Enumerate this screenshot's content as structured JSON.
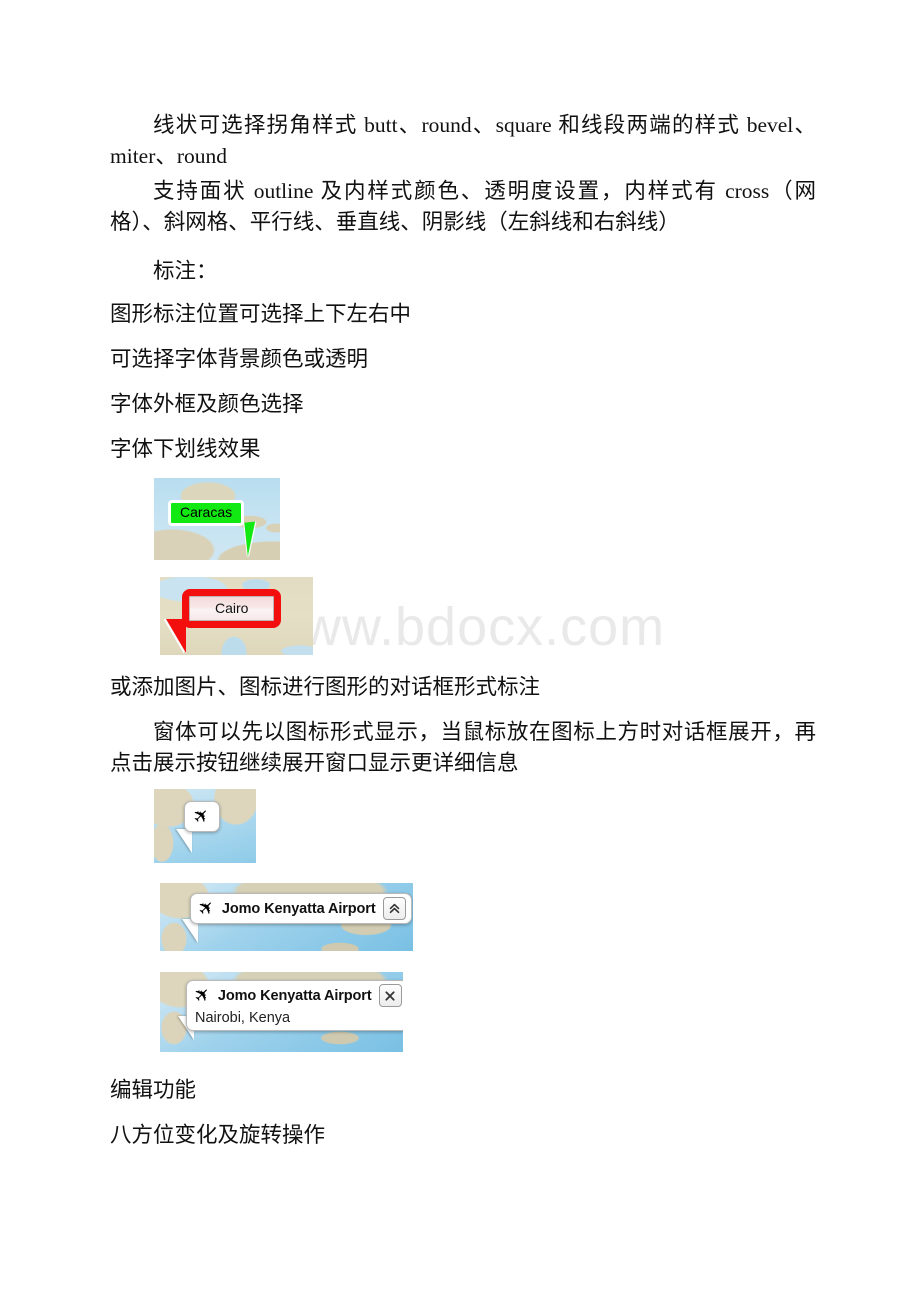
{
  "document": {
    "watermark": "www.bdocx.com",
    "paragraphs": [
      {
        "id": "p1",
        "text": "线状可选择拐角样式 butt、round、square 和线段两端的样式 bevel、miter、round",
        "indent": true
      },
      {
        "id": "p2",
        "text": "支持面状 outline 及内样式颜色、透明度设置，内样式有 cross（网格）、斜网格、平行线、垂直线、阴影线（左斜线和右斜线）",
        "indent": true
      },
      {
        "id": "p3",
        "text": "标注：",
        "indent": true
      },
      {
        "id": "p4",
        "text": "图形标注位置可选择上下左右中",
        "indent": false
      },
      {
        "id": "p5",
        "text": "可选择字体背景颜色或透明",
        "indent": false
      },
      {
        "id": "p6",
        "text": "字体外框及颜色选择",
        "indent": false
      },
      {
        "id": "p7",
        "text": "字体下划线效果",
        "indent": false
      },
      {
        "id": "p8",
        "text": "或添加图片、图标进行图形的对话框形式标注",
        "indent": false
      },
      {
        "id": "p9",
        "text": "窗体可以先以图标形式显示，当鼠标放在图标上方时对话框展开，再点击展示按钮继续展开窗口显示更详细信息",
        "indent": true
      },
      {
        "id": "p10",
        "text": "编辑功能",
        "indent": false
      },
      {
        "id": "p11",
        "text": "八方位变化及旋转操作",
        "indent": false
      }
    ],
    "figures": {
      "caracas": {
        "label": "Caracas",
        "fill_color": "#12e812",
        "border_color": "#ffffff",
        "map_region": "Caribbean"
      },
      "cairo": {
        "label": "Cairo",
        "fill_color": "#f6e6e6",
        "border_color": "#f40f0f",
        "map_region": "Eastern Mediterranean"
      },
      "plane_icon": {
        "icon": "airplane-icon",
        "map_region": "Indian Ocean"
      },
      "airport_collapsed": {
        "icon": "airplane-icon",
        "title": "Jomo Kenyatta Airport",
        "button_icon": "chevron-double-up-icon",
        "button_label": "⌃",
        "map_region": "Indian Ocean"
      },
      "airport_expanded": {
        "icon": "airplane-icon",
        "title": "Jomo Kenyatta Airport",
        "subtitle": "Nairobi, Kenya",
        "button_icon": "close-icon",
        "button_label": "✕",
        "map_region": "Indian Ocean"
      }
    }
  }
}
